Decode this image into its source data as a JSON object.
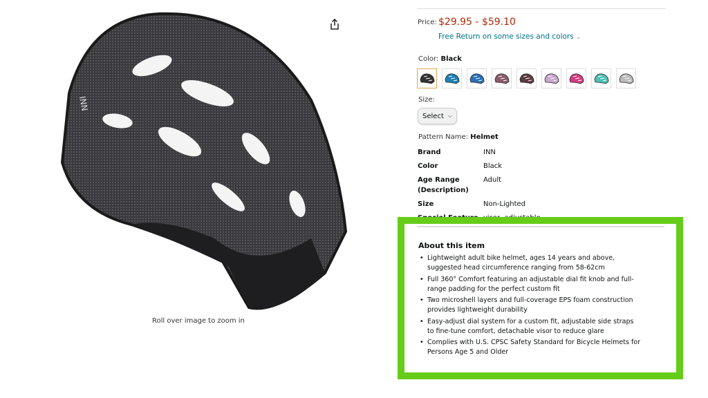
{
  "gallery": {
    "zoom_hint": "Roll over image to zoom in",
    "share_icon": "share-icon"
  },
  "price": {
    "label": "Price:",
    "value": "$29.95 - $59.10",
    "color": "#b12704"
  },
  "free_return": "Free Return on some sizes and colors",
  "color": {
    "label": "Color:",
    "selected": "Black",
    "swatches": [
      "#333333",
      "#1e7fb5",
      "#2a6fb8",
      "#8a5a6b",
      "#5a3a40",
      "#c7a8c9",
      "#d63c7f",
      "#4fc0b5",
      "#bbbbbb"
    ]
  },
  "size": {
    "label": "Size:",
    "select_value": "Select"
  },
  "pattern": {
    "label": "Pattern Name:",
    "value": "Helmet"
  },
  "specs": [
    {
      "key": "Brand",
      "value": "INN"
    },
    {
      "key": "Color",
      "value": "Black"
    },
    {
      "key": "Age Range (Description)",
      "value": "Adult"
    },
    {
      "key": "Size",
      "value": "Non-Lighted"
    },
    {
      "key": "Special Feature",
      "value": "visor, adjustable"
    }
  ],
  "about": {
    "title": "About this item",
    "bullets": [
      "Lightweight adult bike helmet, ages 14 years and above, suggested head circumference ranging from 58-62cm",
      "Full 360° Comfort featuring an adjustable dial fit knob and full-range padding for the perfect custom fit",
      "Two microshell layers and full-coverage EPS foam construction provides lightweight durability",
      "Easy-adjust dial system for a custom fit, adjustable side straps to fine-tune comfort, detachable visor to reduce glare",
      "Complies with U.S. CPSC Safety Standard for Bicycle Helmets for Persons Age 5 and Older"
    ],
    "highlight_color": "#66cc1a"
  }
}
